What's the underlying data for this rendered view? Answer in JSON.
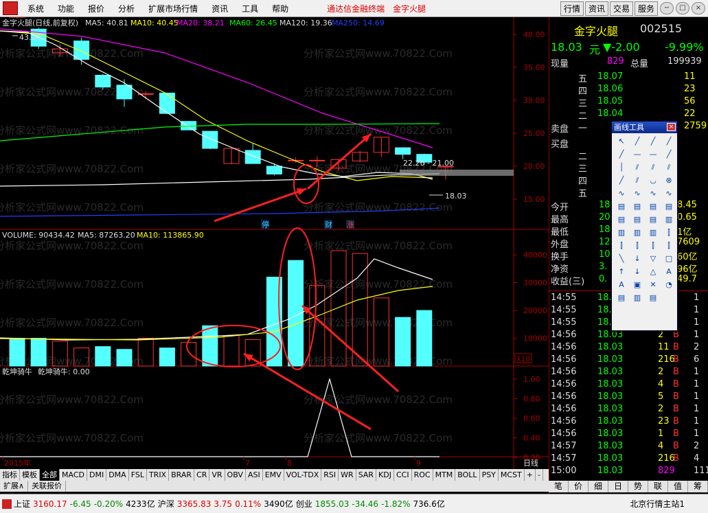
{
  "menubar": {
    "items": [
      "系统",
      "功能",
      "报价",
      "分析",
      "扩展市场行情",
      "资讯",
      "工具",
      "帮助"
    ],
    "brand1": "通达信金融终端",
    "brand2": "金字火腿",
    "right_buttons": [
      "行情",
      "资讯",
      "交易",
      "服务"
    ],
    "win_icons": [
      "−",
      "□",
      "×"
    ]
  },
  "kline": {
    "title": "金字火腿(日线,前复权)",
    "ma5": "MA5: 40.81",
    "ma10": "MA10: 40.45",
    "ma20": "MA20: 38.21",
    "ma60": "MA60: 26.45",
    "ma120": "MA120: 19.36",
    "ma250": "MA250: 14.69",
    "high_label": "43.00",
    "low_label": "18.03",
    "range_label": "22.26 - 21.00",
    "badges": [
      "停",
      "财",
      "涨"
    ],
    "yticks": [
      "40.00",
      "35.00",
      "30.00",
      "25.00",
      "20.00",
      "15.00"
    ]
  },
  "volume": {
    "title": "VOLUME: 90434.42",
    "ma5": "MA5: 87263.20",
    "ma10": "MA10: 113865.90",
    "yticks": [
      "40000",
      "30000",
      "20000",
      "10000"
    ],
    "unit": "X10"
  },
  "indicator": {
    "name": "乾坤骑牛",
    "title": "乾坤骑牛: 0.00",
    "yticks": [
      "1.00",
      "0.80",
      "0.60",
      "0.40",
      "0.20"
    ]
  },
  "xaxis": {
    "labels": [
      "2015年",
      "7",
      "8",
      "9"
    ],
    "period": "日线"
  },
  "watermark": "分析家公式网www.70822.Com",
  "tabs": [
    "指标",
    "模板",
    "全部",
    "MACD",
    "DMI",
    "DMA",
    "FSL",
    "TRIX",
    "BRAR",
    "CR",
    "VR",
    "OBV",
    "ASI",
    "EMV",
    "VOL-TDX",
    "RSI",
    "WR",
    "SAR",
    "KDJ",
    "CCI",
    "ROC",
    "MTM",
    "BOLL",
    "PSY",
    "MCST",
    "+",
    "-"
  ],
  "tabs2": [
    "扩展∧",
    "关联报价"
  ],
  "right": {
    "name": "金字火腿",
    "code": "002515",
    "price": "18.03",
    "unit": "元",
    "change": "-2.00",
    "pct": "-9.99%",
    "xianliang_label": "现量",
    "xianliang": "829",
    "zongliang_label": "总量",
    "zongliang": "199939",
    "asks": [
      {
        "lvl": "五",
        "p": "18.07",
        "v": "11"
      },
      {
        "lvl": "四",
        "p": "18.06",
        "v": "23"
      },
      {
        "lvl": "三",
        "p": "18.05",
        "v": "56"
      },
      {
        "lvl": "二",
        "p": "18.04",
        "v": "22"
      },
      {
        "lvl": "一",
        "p": "",
        "v": "2759"
      }
    ],
    "maipan": "卖盘",
    "buypan": "买盘",
    "bids": [
      "一",
      "二",
      "三",
      "四",
      "五"
    ],
    "stats": [
      {
        "k": "今开",
        "a": "18.",
        "b": "8.45"
      },
      {
        "k": "最高",
        "a": "20.",
        "b": "0.65"
      },
      {
        "k": "最低",
        "a": "18.",
        "b": "1亿"
      },
      {
        "k": "外盘",
        "a": "1223",
        "b": "7609"
      },
      {
        "k": "换手",
        "a": "10.1",
        "b": "60亿"
      },
      {
        "k": "净资",
        "a": "3.",
        "b": "96亿"
      },
      {
        "k": "收益(三)",
        "a": "0.",
        "b": "49.7"
      }
    ],
    "ticks": [
      {
        "t": "14:55",
        "p": "18.",
        "v": "",
        "f": "",
        "n": "1"
      },
      {
        "t": "14:55",
        "p": "18.",
        "v": "",
        "f": "",
        "n": "1"
      },
      {
        "t": "14:55",
        "p": "18.",
        "v": "",
        "f": "",
        "n": "1"
      },
      {
        "t": "14:56",
        "p": "18.03",
        "v": "2",
        "f": "B",
        "n": "1"
      },
      {
        "t": "14:56",
        "p": "18.03",
        "v": "11",
        "f": "B",
        "n": "2"
      },
      {
        "t": "14:56",
        "p": "18.03",
        "v": "216",
        "f": "B",
        "n": "6"
      },
      {
        "t": "14:56",
        "p": "18.03",
        "v": "2",
        "f": "B",
        "n": "1"
      },
      {
        "t": "14:56",
        "p": "18.03",
        "v": "4",
        "f": "B",
        "n": "1"
      },
      {
        "t": "14:56",
        "p": "18.03",
        "v": "5",
        "f": "B",
        "n": "1"
      },
      {
        "t": "14:56",
        "p": "18.03",
        "v": "2",
        "f": "B",
        "n": "1"
      },
      {
        "t": "14:56",
        "p": "18.03",
        "v": "23",
        "f": "B",
        "n": "1"
      },
      {
        "t": "14:56",
        "p": "18.03",
        "v": "1",
        "f": "B",
        "n": "1"
      },
      {
        "t": "14:57",
        "p": "18.03",
        "v": "4",
        "f": "B",
        "n": "2"
      },
      {
        "t": "14:57",
        "p": "18.03",
        "v": "216",
        "f": "B",
        "n": "4"
      },
      {
        "t": "15:00",
        "p": "18.03",
        "v": "829",
        "f": "",
        "n": "111"
      }
    ],
    "tabs": [
      "笔",
      "价",
      "细",
      "日",
      "势",
      "联",
      "值",
      "筹"
    ]
  },
  "drawtool": {
    "title": "画线工具",
    "close": "×"
  },
  "status": {
    "sh_label": "上证",
    "sh": "3160.17",
    "sh_chg": "-6.45",
    "sh_pct": "-0.20%",
    "sh_amt": "4233亿",
    "hs_label": "沪深",
    "hs": "3365.83",
    "hs_chg": "3.75",
    "hs_pct": "0.11%",
    "hs_amt": "3490亿",
    "cy_label": "创业",
    "cy": "1855.03",
    "cy_chg": "-34.46",
    "cy_pct": "-1.82%",
    "cy_amt": "736.6亿",
    "server": "北京行情主站1"
  },
  "colors": {
    "up": "#ff3232",
    "down": "#54ffff",
    "ma5": "#ffffff",
    "ma10": "#ffff00",
    "ma20": "#ff00ff",
    "ma60": "#00ff00",
    "ma120": "#ffffff",
    "ma250": "#2040ff",
    "annot": "#ff2020"
  },
  "candles": [
    {
      "o": 42.6,
      "c": 43.0,
      "h": 43.0,
      "l": 42.4
    },
    {
      "o": 40.8,
      "c": 38.2,
      "h": 41.0,
      "l": 37.8
    },
    {
      "o": 37.2,
      "c": 37.8,
      "h": 38.5,
      "l": 36.6
    },
    {
      "o": 39.0,
      "c": 36.2,
      "h": 39.5,
      "l": 35.4
    },
    {
      "o": 33.8,
      "c": 32.0,
      "h": 34.0,
      "l": 31.6
    },
    {
      "o": 32.3,
      "c": 30.2,
      "h": 33.2,
      "l": 29.0
    },
    {
      "o": 31.0,
      "c": 31.0,
      "h": 31.4,
      "l": 30.2
    },
    {
      "o": 31.1,
      "c": 28.0,
      "h": 31.1,
      "l": 27.9
    },
    {
      "o": 26.8,
      "c": 25.5,
      "h": 26.8,
      "l": 25.5
    },
    {
      "o": 25.3,
      "c": 22.7,
      "h": 25.3,
      "l": 22.6
    },
    {
      "o": 20.4,
      "c": 22.7,
      "h": 22.7,
      "l": 20.3
    },
    {
      "o": 22.4,
      "c": 20.4,
      "h": 23.5,
      "l": 20.4
    },
    {
      "o": 20.0,
      "c": 18.8,
      "h": 20.4,
      "l": 18.6
    },
    {
      "o": 20.9,
      "c": 20.9,
      "h": 21.3,
      "l": 20.5
    },
    {
      "o": 20.9,
      "c": 20.9,
      "h": 21.5,
      "l": 19.9
    },
    {
      "o": 19.7,
      "c": 21.0,
      "h": 21.0,
      "l": 19.3
    },
    {
      "o": 20.8,
      "c": 22.1,
      "h": 22.3,
      "l": 20.6
    },
    {
      "o": 22.1,
      "c": 24.4,
      "h": 24.4,
      "l": 21.4
    },
    {
      "o": 22.8,
      "c": 21.8,
      "h": 22.8,
      "l": 21.1
    },
    {
      "o": 21.8,
      "c": 20.6,
      "h": 21.9,
      "l": 20.2
    },
    {
      "o": 20.0,
      "c": 20.0,
      "h": 20.0,
      "l": 18.0
    }
  ],
  "vols": [
    10000,
    10000,
    9000,
    6500,
    7000,
    6000,
    10000,
    6500,
    8500,
    14500,
    11000,
    9500,
    32000,
    38000,
    29000,
    41500,
    40500,
    24500,
    17500,
    20000
  ],
  "up_flags": [
    0,
    0,
    1,
    1,
    0,
    0,
    1,
    0,
    1,
    0,
    1,
    1,
    0,
    0,
    1,
    1,
    1,
    1,
    0,
    0,
    0
  ]
}
